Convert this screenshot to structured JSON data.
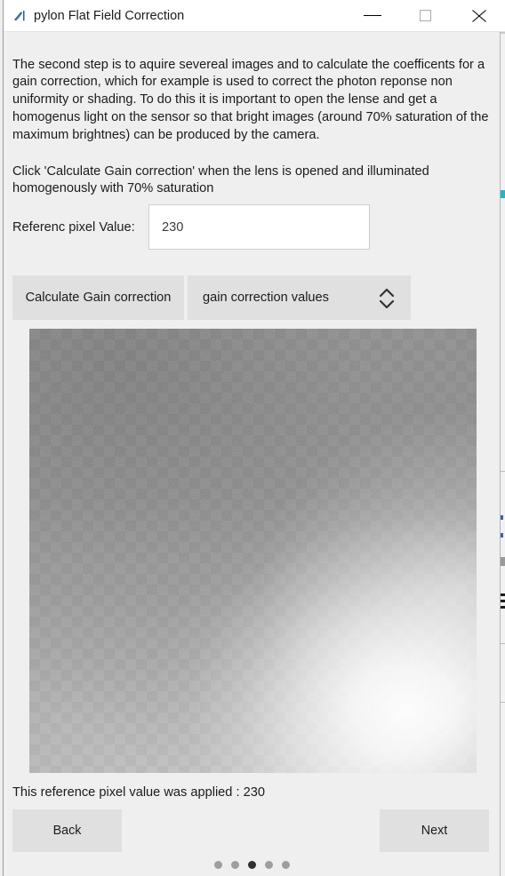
{
  "window": {
    "title": "pylon Flat Field Correction",
    "icon": "pylon-app-icon",
    "controls": {
      "minimize": "minimize-icon",
      "maximize": "maximize-icon",
      "close": "close-icon"
    }
  },
  "body": {
    "paragraph_1": "The second step is to aquire severeal images and to calculate the coefficents for a gain correction, which for example is used to correct the photon reponse non uniformity or shading. To do this it is important to open the lense and get a homogenus light on the sensor so that bright images (around 70% saturation of the maximum brightnes) can be produced by the camera.",
    "paragraph_2": "Click 'Calculate Gain correction' when the lens is opened and illuminated homogenously with 70% saturation"
  },
  "reference": {
    "label": "Referenc pixel Value:",
    "value": "230",
    "placeholder": ""
  },
  "actions": {
    "calculate_label": "Calculate Gain correction",
    "spinner_label": "gain correction values",
    "spinner_icon": "updown-chevron-icon"
  },
  "preview": {
    "alt": "flat-field-captured-image"
  },
  "status": {
    "text": "This reference pixel value was applied : 230"
  },
  "navigation": {
    "back_label": "Back",
    "next_label": "Next",
    "step_count": 5,
    "active_step": 3
  },
  "colors": {
    "window_background": "#efefef",
    "titlebar_background": "#ffffff",
    "button_face": "#e0e0e0",
    "text": "#1b1b1b",
    "input_background": "#ffffff",
    "input_border": "#cdcdcd",
    "dot_inactive": "#9e9e9e",
    "dot_active": "#2f2f2f",
    "icon_blue": "#2e5d8f"
  }
}
